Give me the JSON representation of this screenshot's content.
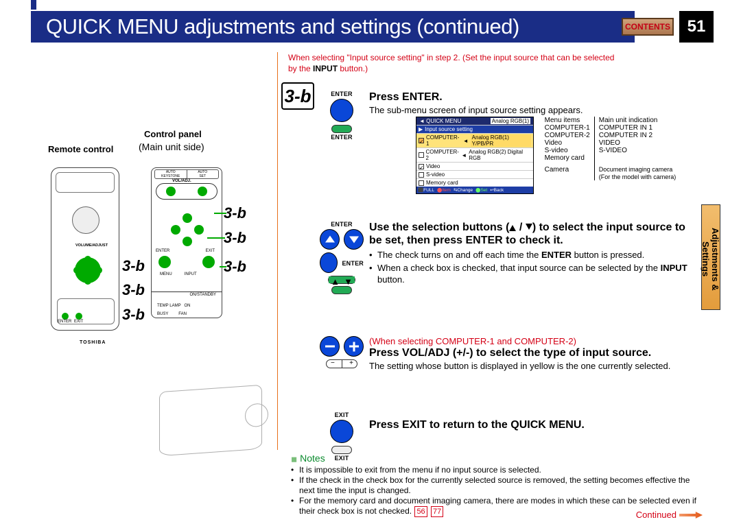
{
  "domain": "Document",
  "header": {
    "title": "QUICK MENU adjustments and settings (continued)",
    "contents": "CONTENTS",
    "page": "51"
  },
  "sidetab": "Adjustments & Settings",
  "left": {
    "remote": "Remote control",
    "panel": "Control panel",
    "panel_sub": "(Main unit side)",
    "lab": "3-b"
  },
  "step": "3-b",
  "top_red_note": {
    "t1": "When selecting \"Input source setting\" in step 2. (Set the input source that can be selected",
    "t2": "by the ",
    "b": "INPUT",
    "t3": " button.)"
  },
  "s1": {
    "iconlabel_top": "ENTER",
    "iconlabel_bot": "ENTER",
    "h": "Press ENTER.",
    "p": "The sub-menu screen of input source setting appears."
  },
  "inset": {
    "title_l": "QUICK MENU",
    "title_r": "Analog RGB(1)",
    "row_head": "Input source setting",
    "rows": [
      {
        "k": "COMPUTER-1",
        "v": "Analog RGB(1) Y/PB/PR"
      },
      {
        "k": "COMPUTER-2",
        "v": "Analog RGB(2) Digital RGB"
      },
      {
        "k": "Video",
        "v": ""
      },
      {
        "k": "S-video",
        "v": ""
      },
      {
        "k": "Memory card",
        "v": ""
      }
    ],
    "foot": [
      "FULL",
      "Item",
      "Change",
      "Set",
      "Back"
    ],
    "rh": [
      "Menu items",
      "Main unit indication"
    ],
    "rrows": [
      [
        "COMPUTER-1",
        "COMPUTER IN 1"
      ],
      [
        "COMPUTER-2",
        "COMPUTER IN 2"
      ],
      [
        "Video",
        "VIDEO"
      ],
      [
        "S-video",
        "S-VIDEO"
      ],
      [
        "Memory card",
        ""
      ],
      [
        "Camera",
        "Document imaging camera"
      ]
    ],
    "rnote": "(For the model with camera)"
  },
  "s2": {
    "iconlabel_top": "ENTER",
    "iconlabel_bot": "ENTER",
    "h1": "Use the selection buttons (",
    "h2": " / ",
    "h3": ") to select the input source to be set, then press ENTER to check it.",
    "b1": "The check turns on and off each time the ",
    "b1b": "ENTER",
    "b1c": " button is pressed.",
    "b2": "When a check box is checked, that input source can be selected by the ",
    "b2b": "INPUT",
    "b2c": " button."
  },
  "s3": {
    "red": "(When selecting COMPUTER-1 and COMPUTER-2)",
    "h": "Press VOL/ADJ (+/-) to select the type of input source.",
    "p": "The setting whose button is displayed in yellow is the one currently selected."
  },
  "s4": {
    "iconlabel_top": "EXIT",
    "iconlabel_bot": "EXIT",
    "h": "Press EXIT to return to the QUICK MENU."
  },
  "notes": {
    "h": "Notes",
    "n1": "It is impossible to exit from the menu if no input source is selected.",
    "n2": "If the check in the check box for the currently selected source is removed, the setting becomes effective the next time the input is changed.",
    "n3a": "For the memory card and document imaging camera, there are modes in which these can be selected even if their check box is not checked.",
    "ref1": "56",
    "ref2": "77"
  },
  "continued": "Continued"
}
